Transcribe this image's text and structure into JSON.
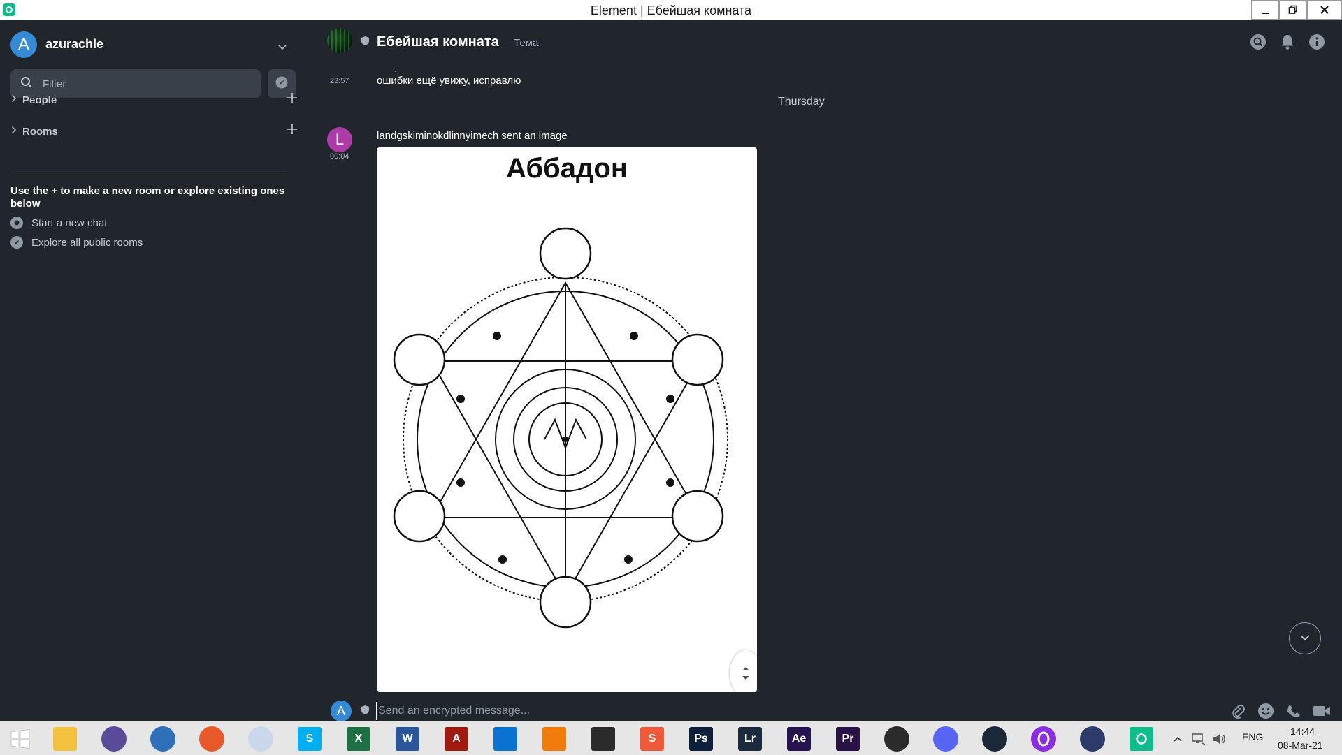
{
  "window": {
    "title": "Element | Ебейшая комната"
  },
  "sidebar": {
    "account_initial": "A",
    "account_name": "azurachle",
    "filter_placeholder": "Filter",
    "sections": [
      {
        "label": "People"
      },
      {
        "label": "Rooms"
      }
    ],
    "hint": "Use the + to make a new room or explore existing ones below",
    "links": [
      {
        "label": "Start a new chat",
        "icon": "chat-bubble-icon"
      },
      {
        "label": "Explore all public rooms",
        "icon": "compass-icon"
      }
    ]
  },
  "room": {
    "name": "Ебейшая комната",
    "topic": "Тема",
    "header_icons": [
      "search-icon",
      "bell-icon",
      "info-icon"
    ]
  },
  "timeline": {
    "continuation_marker": ".",
    "messages": [
      {
        "time": "23:57",
        "text": "ошибки ещё увижу, исправлю"
      },
      {
        "time": "00:04",
        "sender_initial": "L",
        "text": "landgskiminokdlinnyimech sent an image",
        "image_title": "Аббадон"
      }
    ],
    "day_separator": "Thursday"
  },
  "composer": {
    "avatar_initial": "A",
    "placeholder": "Send an encrypted message...",
    "icons": [
      "attachment-icon",
      "emoji-icon",
      "voice-call-icon",
      "video-call-icon"
    ]
  },
  "taskbar": {
    "language": "ENG",
    "time": "14:44",
    "date": "08-Mar-21",
    "apps": [
      {
        "name": "start",
        "color": "#e6e6e6"
      },
      {
        "name": "file-explorer",
        "color": "#f3c23f"
      },
      {
        "name": "bittorrent",
        "color": "#5a4b9a"
      },
      {
        "name": "thunderbird",
        "color": "#2e6fb8"
      },
      {
        "name": "firefox",
        "color": "#e8592a"
      },
      {
        "name": "moon-app",
        "color": "#c9d8ea"
      },
      {
        "name": "skype",
        "color": "#00aff0"
      },
      {
        "name": "excel",
        "color": "#1e7145"
      },
      {
        "name": "word",
        "color": "#2b579a"
      },
      {
        "name": "acrobat",
        "color": "#a01a10"
      },
      {
        "name": "vscode",
        "color": "#0a73d1"
      },
      {
        "name": "vlc",
        "color": "#f07d0b"
      },
      {
        "name": "downloader",
        "color": "#2b2b2b"
      },
      {
        "name": "sublime",
        "color": "#ef5a3a"
      },
      {
        "name": "photoshop",
        "color": "#0e1f3a"
      },
      {
        "name": "lightroom",
        "color": "#1b2a3d"
      },
      {
        "name": "after-effects",
        "color": "#26144f"
      },
      {
        "name": "premiere",
        "color": "#2a1247"
      },
      {
        "name": "obs",
        "color": "#2b2b2b"
      },
      {
        "name": "discord",
        "color": "#5865f2"
      },
      {
        "name": "steam",
        "color": "#1b2838"
      },
      {
        "name": "opera-gx",
        "color": "#8b2de0"
      },
      {
        "name": "vpn",
        "color": "#2d3b6b"
      },
      {
        "name": "element",
        "color": "#0dbd8b"
      }
    ]
  },
  "colors": {
    "accent": "#0dbd8b",
    "sidebar_bg": "#21262c",
    "field_bg": "#394049",
    "account_avatar": "#368bd6",
    "sender_avatar": "#ac3ba8"
  }
}
